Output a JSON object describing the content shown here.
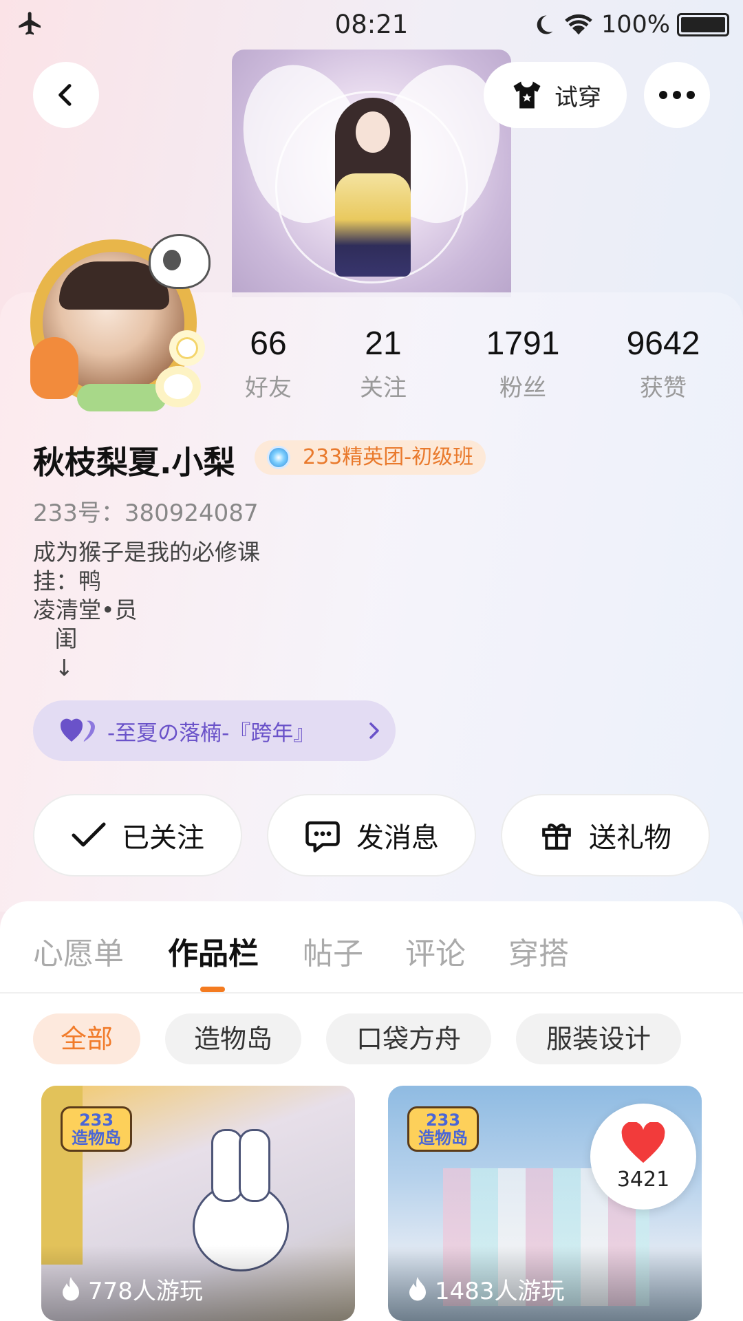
{
  "status_bar": {
    "time": "08:21",
    "battery": "100%"
  },
  "header": {
    "try_on_label": "试穿"
  },
  "stats": [
    {
      "value": "66",
      "label": "好友"
    },
    {
      "value": "21",
      "label": "关注"
    },
    {
      "value": "1791",
      "label": "粉丝"
    },
    {
      "value": "9642",
      "label": "获赞"
    }
  ],
  "profile": {
    "name": "秋枝梨夏.小梨",
    "badge": "233精英团-初级班",
    "uid": "233号：380924087",
    "bio": "成为猴子是我的必修课\n挂：鸭\n凌清堂•员\n   闺\n   ↓",
    "group": "-至夏の落楠-『跨年』"
  },
  "actions": {
    "follow": "已关注",
    "message": "发消息",
    "gift": "送礼物"
  },
  "tabs": [
    "心愿单",
    "作品栏",
    "帖子",
    "评论",
    "穿搭"
  ],
  "active_tab": "作品栏",
  "filters": [
    "全部",
    "造物岛",
    "口袋方舟",
    "服装设计"
  ],
  "cards": [
    {
      "logo": "233\n造物岛",
      "plays": "778人游玩"
    },
    {
      "logo": "233\n造物岛",
      "plays": "1483人游玩"
    }
  ],
  "like_count": "3421",
  "colors": {
    "accent": "#f47b20",
    "group_purple": "#6a52c9",
    "badge_orange": "#e97a2d"
  }
}
